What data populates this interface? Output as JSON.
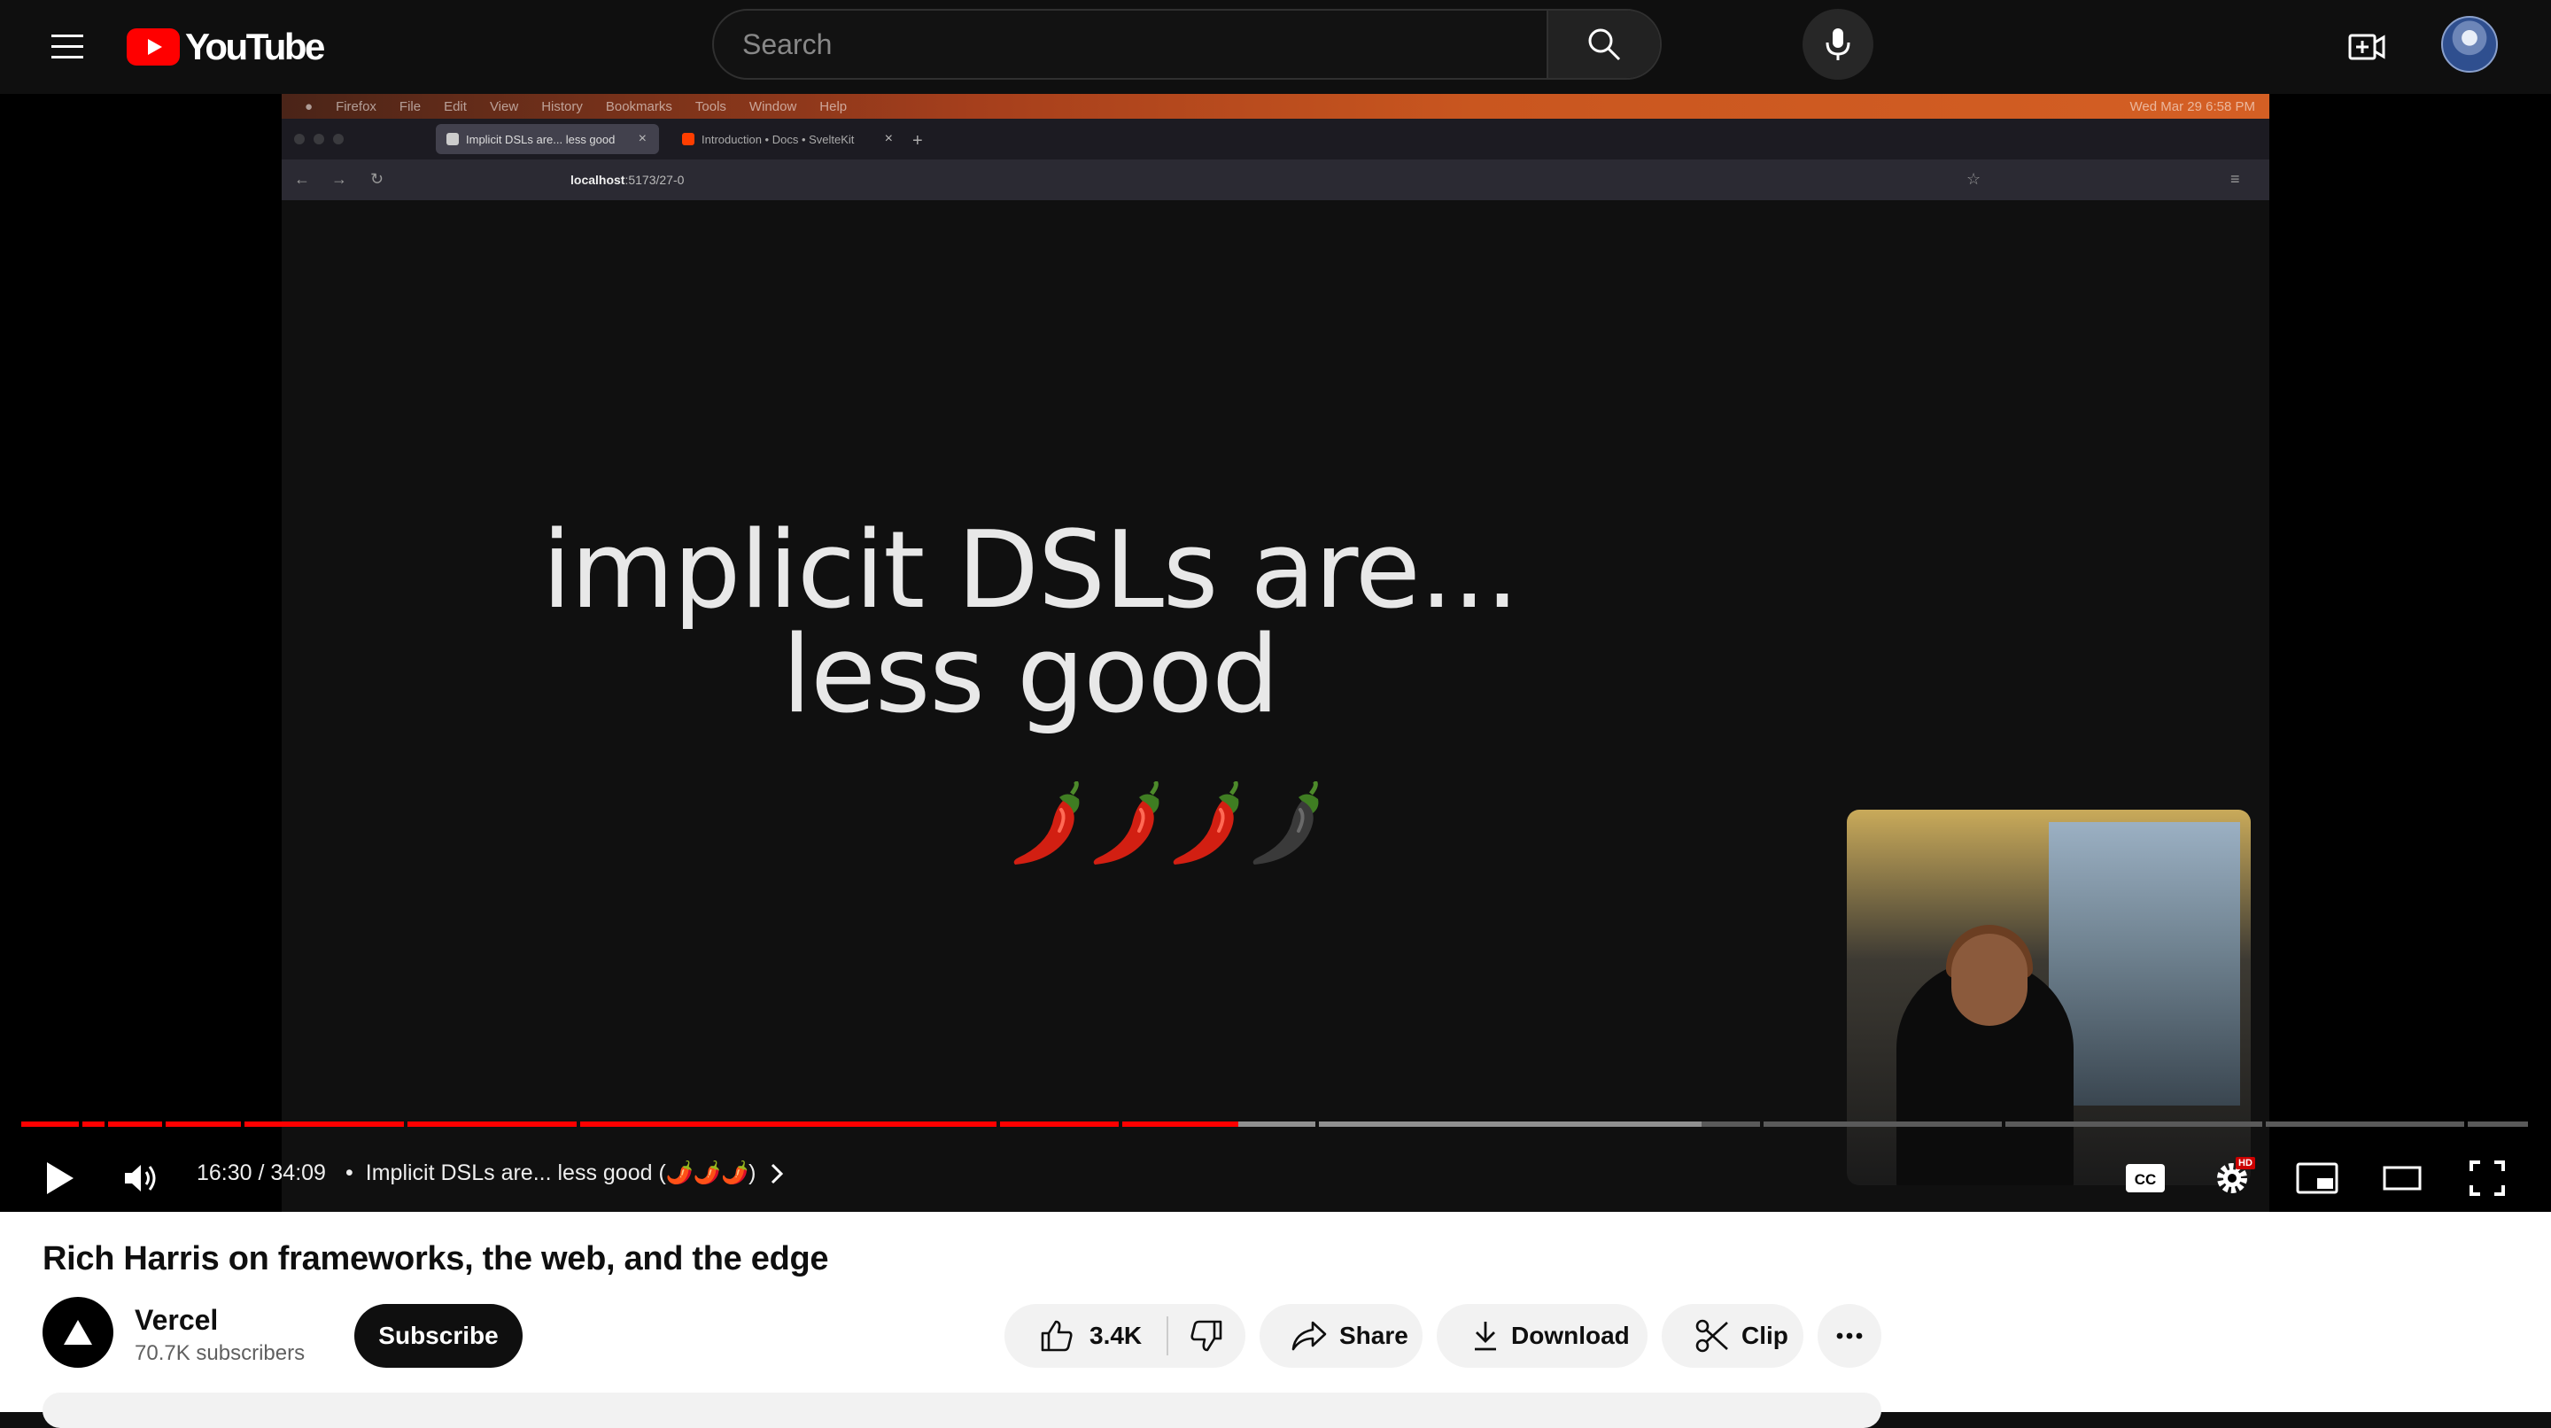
{
  "masthead": {
    "logo_text": "YouTube",
    "search_placeholder": "Search"
  },
  "video_content": {
    "mac_menu": [
      "Firefox",
      "File",
      "Edit",
      "View",
      "History",
      "Bookmarks",
      "Tools",
      "Window",
      "Help"
    ],
    "mac_clock": "Wed Mar 29  6:58 PM",
    "browser_tabs": [
      {
        "label": "Implicit DSLs are... less good",
        "active": true
      },
      {
        "label": "Introduction • Docs • SvelteKit",
        "active": false
      }
    ],
    "url_host": "localhost",
    "url_rest": ":5173/27-0",
    "slide_line1": "implicit DSLs are...",
    "slide_line2": "less good",
    "pepper_rating": {
      "hot": 3,
      "total": 4
    }
  },
  "player": {
    "progress_fraction": 0.485,
    "buffered_fraction": 0.67,
    "time_current": "16:30",
    "time_total": "34:09",
    "time_display": "16:30 / 34:09",
    "chapter_separator": "•",
    "chapter_title": "Implicit DSLs are... less good (🌶️🌶️🌶️)",
    "colors": {
      "played": "#ff0000",
      "buffered": "#909090",
      "track": "#5a5a5a"
    },
    "hd_badge": "HD"
  },
  "video": {
    "title": "Rich Harris on frameworks, the web, and the edge",
    "channel_name": "Vercel",
    "subscriber_count": "70.7K subscribers",
    "subscribe_label": "Subscribe",
    "like_count": "3.4K",
    "share_label": "Share",
    "download_label": "Download",
    "clip_label": "Clip"
  },
  "icons": {
    "menu": "hamburger-menu-icon",
    "search": "search-icon",
    "mic": "microphone-icon",
    "create": "create-video-icon",
    "play": "play-icon",
    "volume": "volume-icon",
    "captions": "captions-icon",
    "settings": "settings-gear-icon",
    "miniplayer": "miniplayer-icon",
    "theater": "theater-mode-icon",
    "fullscreen": "fullscreen-icon"
  }
}
